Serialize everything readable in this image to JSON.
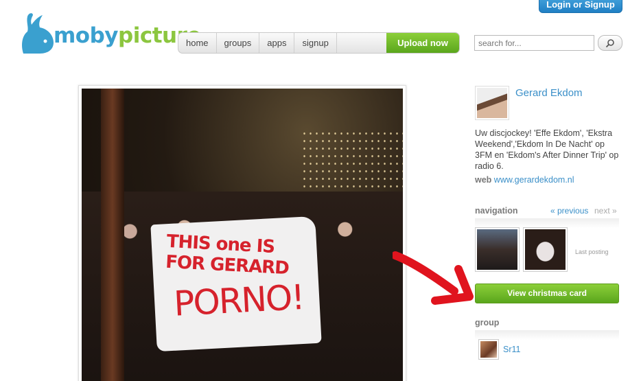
{
  "header": {
    "login_label": "Login or Signup",
    "logo_part1": "moby",
    "logo_part2": "picture",
    "nav": [
      "home",
      "groups",
      "apps",
      "signup"
    ],
    "upload_label": "Upload now",
    "search_placeholder": "search for..."
  },
  "photo": {
    "banner_line1": "THIS one IS FOR GERARD",
    "banner_line2": "PORNO!"
  },
  "user": {
    "name": "Gerard Ekdom",
    "bio": "Uw discjockey! 'Effe Ekdom', 'Ekstra Weekend','Ekdom In De Nacht' op 3FM en 'Ekdom's After Dinner Trip' op radio 6.",
    "web_label": "web",
    "web_url": "www.gerardekdom.nl"
  },
  "navigation": {
    "title": "navigation",
    "prev_label": "« previous",
    "next_label": "next »",
    "last_posting": "Last posting",
    "xmas_button": "View christmas card"
  },
  "group": {
    "title": "group",
    "name": "Sr11"
  },
  "colors": {
    "brand_blue": "#3aa0cf",
    "brand_green": "#8cc63f",
    "link": "#3a8fc8",
    "button_green": "#5aa61c"
  }
}
